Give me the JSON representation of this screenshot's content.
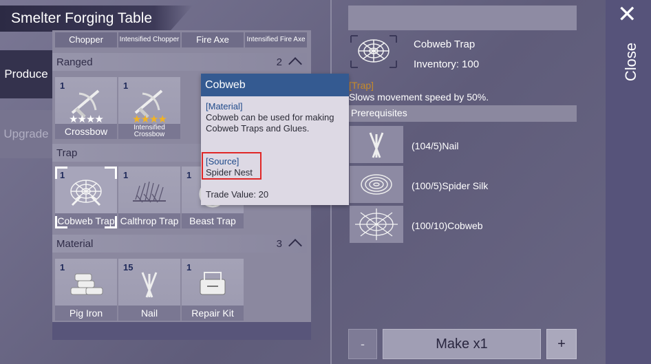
{
  "window": {
    "title": "Smelter Forging Table"
  },
  "side_tabs": [
    "Produce",
    "Upgrade"
  ],
  "category_tabs": [
    "Chopper",
    "Intensified Chopper",
    "Fire Axe",
    "Intensified Fire Axe"
  ],
  "sections": {
    "ranged": {
      "label": "Ranged",
      "count": "2"
    },
    "trap": {
      "label": "Trap"
    },
    "material": {
      "label": "Material",
      "count": "3"
    }
  },
  "items": {
    "crossbow": {
      "qty": "1",
      "name": "Crossbow",
      "stars": "★★★★"
    },
    "intensified_crossbow": {
      "qty": "1",
      "name": "Intensified Crossbow",
      "stars": "★★★★"
    },
    "cobweb_trap": {
      "qty": "1",
      "name": "Cobweb Trap"
    },
    "calthrop_trap": {
      "qty": "1",
      "name": "Calthrop Trap"
    },
    "beast_trap": {
      "qty": "1",
      "name": "Beast Trap"
    },
    "pig_iron": {
      "qty": "1",
      "name": "Pig Iron"
    },
    "nail": {
      "qty": "15",
      "name": "Nail"
    },
    "repair_kit": {
      "qty": "1",
      "name": "Repair Kit"
    }
  },
  "tooltip": {
    "title": "Cobweb",
    "type": "[Material]",
    "description": "Cobweb can be used for making Cobweb Traps and Glues.",
    "source_label": "[Source]",
    "source": "Spider Nest",
    "trade_value": "Trade Value: 20"
  },
  "detail": {
    "name": "Cobweb Trap",
    "inventory": "Inventory: 100",
    "type": "[Trap]",
    "description": "Slows movement speed by 50%.",
    "prereq_label": "Prerequisites",
    "requirements": [
      {
        "label": "(104/5)Nail",
        "icon": "nail-icon"
      },
      {
        "label": "(100/5)Spider Silk",
        "icon": "spider-silk-icon"
      },
      {
        "label": "(100/10)Cobweb",
        "icon": "cobweb-icon"
      }
    ]
  },
  "controls": {
    "minus": "-",
    "make": "Make x1",
    "plus": "+"
  },
  "close": {
    "x": "✕",
    "label": "Close"
  },
  "colors": {
    "star_white": "#ffffff",
    "star_gold": "#f2b322",
    "accent_blue": "#345a91",
    "trap_type": "#c58a2a",
    "highlight_red": "#e02626"
  }
}
